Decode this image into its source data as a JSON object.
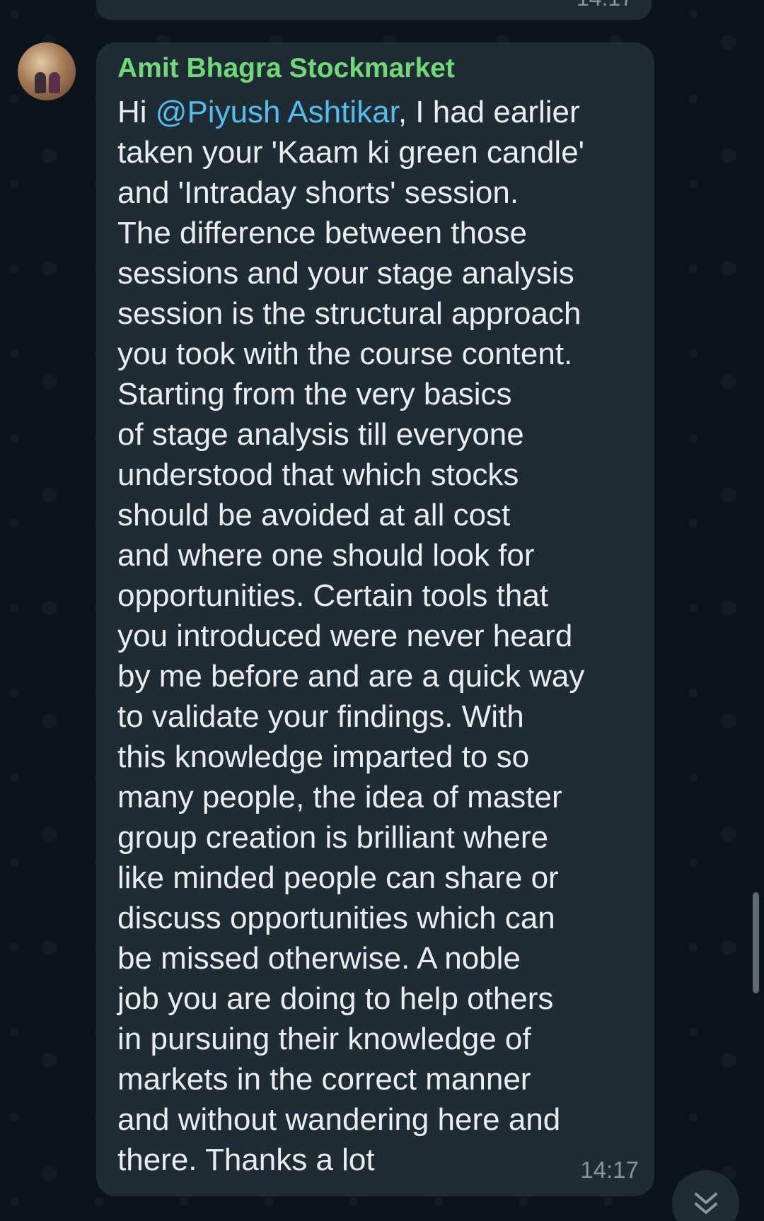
{
  "previous_message": {
    "time": "14:17"
  },
  "message": {
    "sender": "Amit Bhagra Stockmarket",
    "mention": "@Piyush Ashtikar",
    "first_line_prefix": "Hi ",
    "first_line_suffix": ", I had earlier",
    "lines": [
      "taken your 'Kaam ki green candle'",
      "and 'Intraday shorts' session.",
      "The difference between those",
      "sessions and your stage analysis",
      "session is the structural approach",
      "you took with the course content.",
      "Starting from the very basics",
      "of stage analysis till everyone",
      "understood that which stocks",
      "should be avoided at all cost",
      "and where one should look for",
      "opportunities. Certain tools that",
      "you introduced were never heard",
      "by me before and are a quick way",
      "to validate  your findings. With",
      "this knowledge imparted to so",
      "many people, the idea of master",
      "group creation is brilliant where",
      "like minded people can share or",
      "discuss opportunities which can",
      "be missed otherwise. A noble",
      "job you are doing to help others",
      "in pursuing their knowledge of",
      "markets in the correct manner",
      "and without wandering here and",
      "there. Thanks a lot"
    ],
    "time": "14:17"
  },
  "icons": {
    "avatar": "avatar",
    "scroll_down": "chevron-double-down-icon"
  },
  "colors": {
    "background": "#0b141a",
    "bubble": "#202c33",
    "sender": "#71d879",
    "mention": "#53bdeb",
    "text": "#e9edef",
    "timestamp": "#8696a0"
  }
}
